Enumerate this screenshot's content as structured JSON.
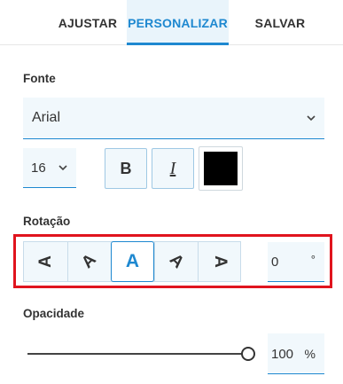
{
  "tabs": [
    {
      "label": "AJUSTAR",
      "active": false
    },
    {
      "label": "PERSONALIZAR",
      "active": true
    },
    {
      "label": "SALVAR",
      "active": false
    }
  ],
  "font": {
    "section_label": "Fonte",
    "family_value": "Arial",
    "size_value": "16",
    "bold_label": "B",
    "italic_label": "I",
    "color": "#000000"
  },
  "rotation": {
    "section_label": "Rotação",
    "options": [
      {
        "glyph": "A",
        "icon": "text-rotate-left-icon",
        "active": false
      },
      {
        "glyph": "A",
        "icon": "text-rotate-up-left-icon",
        "active": false
      },
      {
        "glyph": "A",
        "icon": "text-horizontal-icon",
        "active": true
      },
      {
        "glyph": "A",
        "icon": "text-rotate-up-right-icon",
        "active": false
      },
      {
        "glyph": "A",
        "icon": "text-rotate-right-icon",
        "active": false
      }
    ],
    "value": "0",
    "unit": "°"
  },
  "opacity": {
    "section_label": "Opacidade",
    "value": "100",
    "unit": "%",
    "slider_fraction": 1.0
  },
  "colors": {
    "accent": "#1e88d0",
    "highlight_border": "#e0141e",
    "field_bg": "#f1f8fc"
  }
}
